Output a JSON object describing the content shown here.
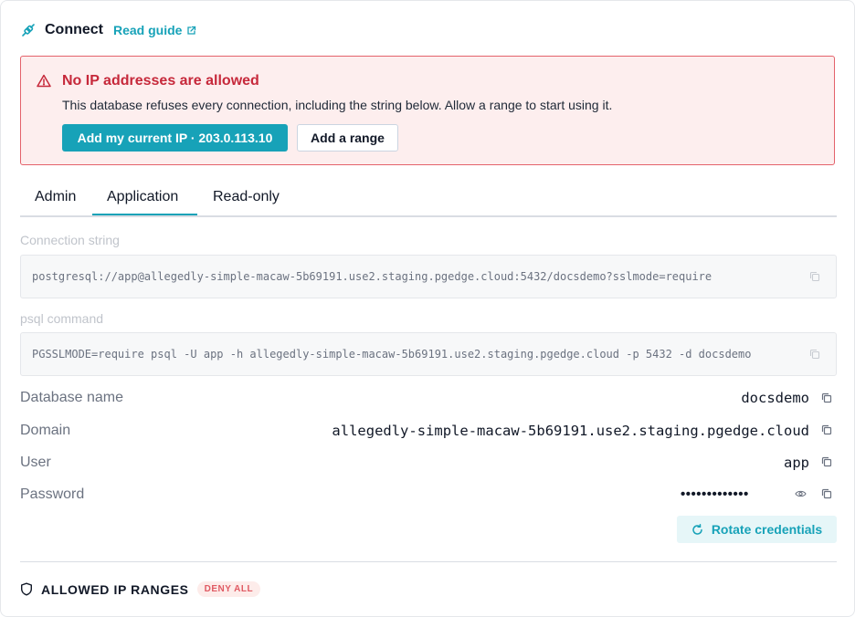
{
  "header": {
    "title": "Connect",
    "guide_link": "Read guide"
  },
  "alert": {
    "title": "No IP addresses are allowed",
    "message": "This database refuses every connection, including the string below. Allow a range to start using it.",
    "primary_button": "Add my current IP · 203.0.113.10",
    "secondary_button": "Add a range"
  },
  "tabs": [
    "Admin",
    "Application",
    "Read-only"
  ],
  "active_tab": "Application",
  "connection_string": {
    "label": "Connection string",
    "value": "postgresql://app@allegedly-simple-macaw-5b69191.use2.staging.pgedge.cloud:5432/docsdemo?sslmode=require"
  },
  "psql_command": {
    "label": "psql command",
    "value": "PGSSLMODE=require psql -U app -h allegedly-simple-macaw-5b69191.use2.staging.pgedge.cloud -p 5432 -d docsdemo"
  },
  "details": [
    {
      "label": "Database name",
      "value": "docsdemo"
    },
    {
      "label": "Domain",
      "value": "allegedly-simple-macaw-5b69191.use2.staging.pgedge.cloud"
    },
    {
      "label": "User",
      "value": "app"
    },
    {
      "label": "Password",
      "value": "•••••••••••••"
    }
  ],
  "rotate_button": "Rotate credentials",
  "allowed_ranges": {
    "title": "ALLOWED IP RANGES",
    "badge": "DENY ALL"
  },
  "colors": {
    "accent": "#17a2b8",
    "danger": "#c6283a",
    "danger_bg": "#fdeeee",
    "badge_bg": "#fdecea"
  },
  "icons": [
    "plug-icon",
    "external-link-icon",
    "warning-icon",
    "copy-icon",
    "eye-icon",
    "refresh-icon",
    "shield-icon"
  ]
}
